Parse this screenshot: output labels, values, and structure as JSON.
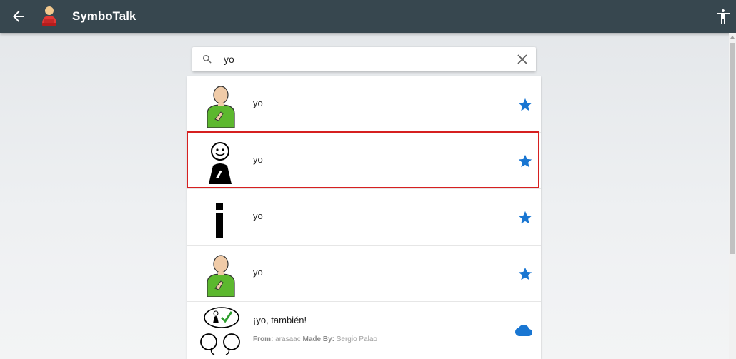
{
  "app": {
    "title": "SymboTalk"
  },
  "search": {
    "query": "yo"
  },
  "results": [
    {
      "label": "yo",
      "action_icon": "star-icon"
    },
    {
      "label": "yo",
      "action_icon": "star-icon",
      "selected": true
    },
    {
      "label": "yo",
      "action_icon": "star-icon"
    },
    {
      "label": "yo",
      "action_icon": "star-icon"
    },
    {
      "label": "¡yo, también!",
      "action_icon": "cloud-icon",
      "from_label": "From:",
      "from_value": "arasaac",
      "made_by_label": "Made By:",
      "made_by_value": "Sergio Palao"
    }
  ],
  "colors": {
    "appbar": "#37474f",
    "accent": "#1976d2",
    "selection": "#d62020"
  }
}
